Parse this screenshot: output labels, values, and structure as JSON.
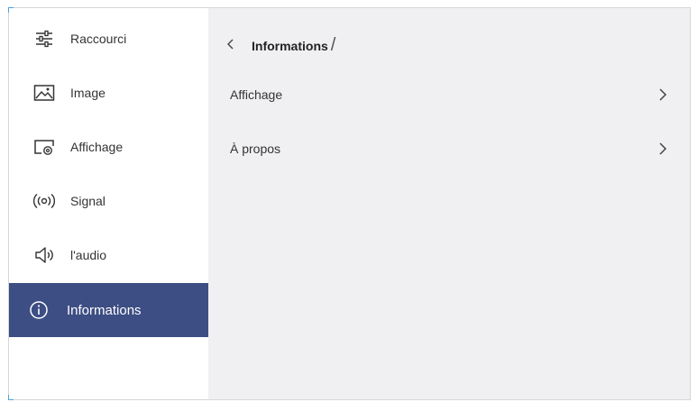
{
  "sidebar": {
    "items": [
      {
        "label": "Raccourci",
        "icon": "sliders-icon"
      },
      {
        "label": "Image",
        "icon": "image-icon"
      },
      {
        "label": "Affichage",
        "icon": "display-settings-icon"
      },
      {
        "label": "Signal",
        "icon": "signal-icon"
      },
      {
        "label": "l'audio",
        "icon": "speaker-icon"
      },
      {
        "label": "Informations",
        "icon": "info-icon",
        "active": true
      }
    ]
  },
  "header": {
    "back_icon": "chevron-left-icon",
    "title": "Informations",
    "separator": "/"
  },
  "main": {
    "rows": [
      {
        "label": "Affichage",
        "icon": "chevron-right-icon"
      },
      {
        "label": "À propos",
        "icon": "chevron-right-icon"
      }
    ]
  },
  "colors": {
    "active_bg": "#3d4e84",
    "panel_bg": "#f0f0f2",
    "accent": "#4aa3df"
  }
}
